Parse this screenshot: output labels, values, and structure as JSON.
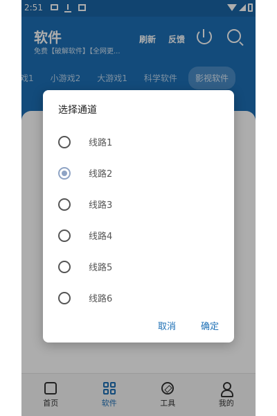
{
  "status_bar": {
    "time": "2:51"
  },
  "header": {
    "title": "软件",
    "subtitle": "免费【破解软件】【全网更...",
    "refresh_label": "刷新",
    "feedback_label": "反馈",
    "icons": [
      "download-icon",
      "search-icon"
    ]
  },
  "tabs": [
    {
      "label": "戏1"
    },
    {
      "label": "小游戏2"
    },
    {
      "label": "大游戏1"
    },
    {
      "label": "科学软件"
    },
    {
      "label": "影视软件",
      "active": true
    }
  ],
  "dialog": {
    "title": "选择通道",
    "options": [
      {
        "label": "线路1",
        "checked": false
      },
      {
        "label": "线路2",
        "checked": true
      },
      {
        "label": "线路3",
        "checked": false
      },
      {
        "label": "线路4",
        "checked": false
      },
      {
        "label": "线路5",
        "checked": false
      },
      {
        "label": "线路6",
        "checked": false
      }
    ],
    "cancel_label": "取消",
    "confirm_label": "确定"
  },
  "bottom_nav": [
    {
      "label": "首页",
      "icon": "home-icon"
    },
    {
      "label": "软件",
      "icon": "grid-icon",
      "active": true
    },
    {
      "label": "工具",
      "icon": "compass-icon"
    },
    {
      "label": "我的",
      "icon": "user-icon"
    }
  ],
  "colors": {
    "primary": "#1c6fb5",
    "status_bar": "#1a65a5",
    "radio_checked": "#8ea3c4"
  }
}
